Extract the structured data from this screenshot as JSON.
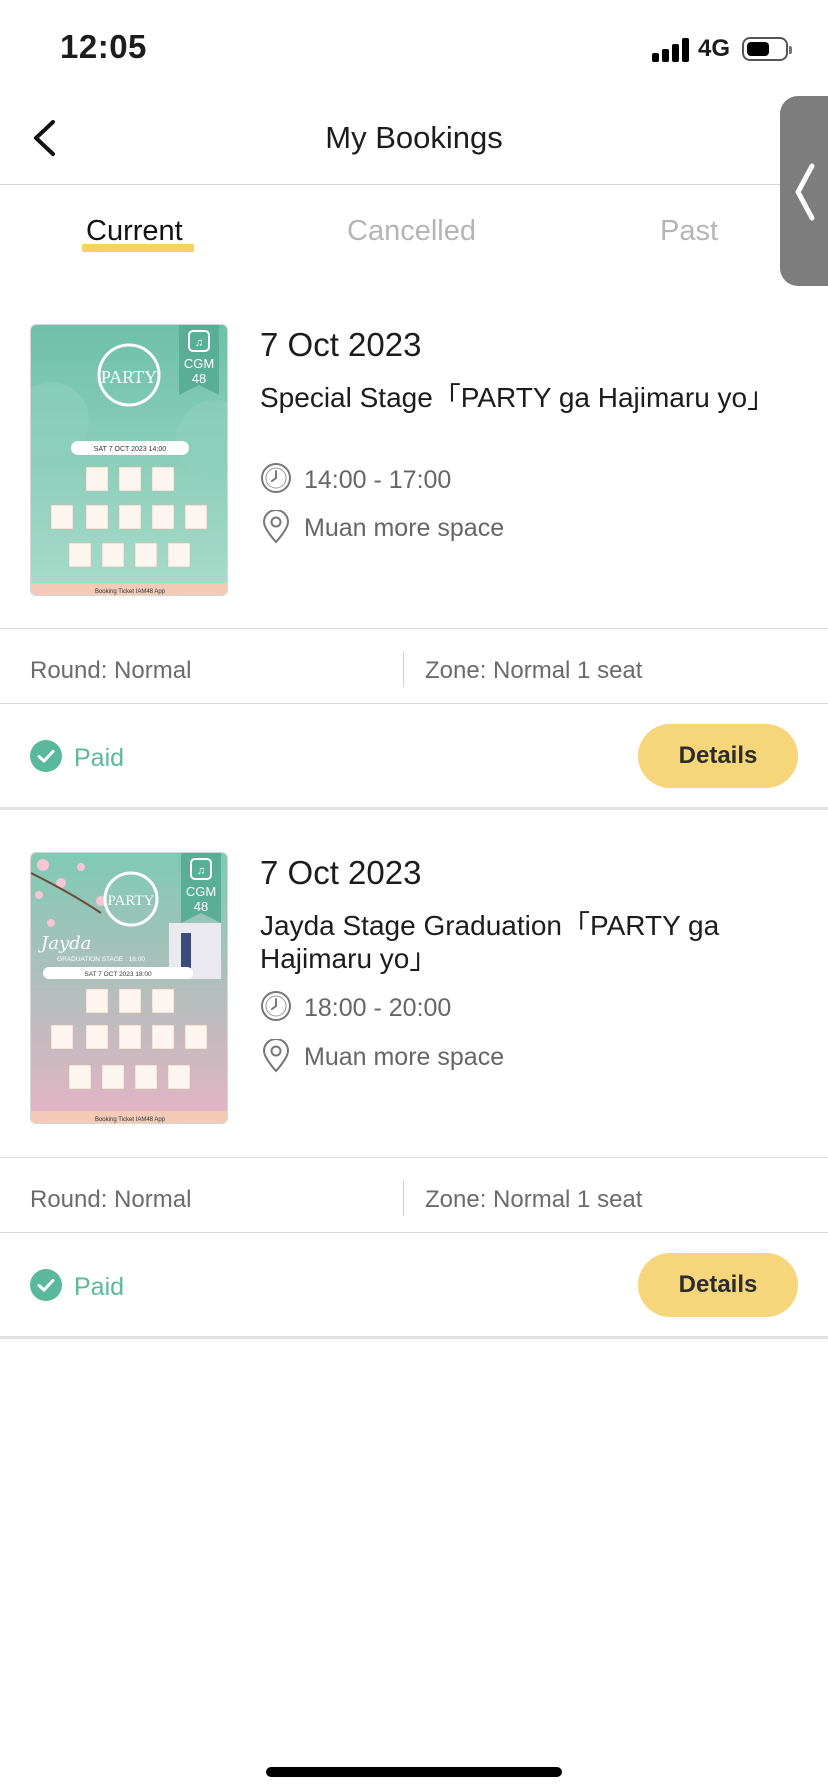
{
  "status_bar": {
    "time": "12:05",
    "network": "4G",
    "battery_level": 0.55
  },
  "nav": {
    "title": "My Bookings",
    "back_icon": "chevron-left-icon",
    "side_handle_icon": "chevron-left-icon"
  },
  "tabs": [
    {
      "label": "Current",
      "active": true
    },
    {
      "label": "Cancelled",
      "active": false
    },
    {
      "label": "Past",
      "active": false
    }
  ],
  "bookings": [
    {
      "date": "7 Oct 2023",
      "title": "Special Stage「PARTY ga Hajimaru yo」",
      "time": "14:00 - 17:00",
      "venue": "Muan more space",
      "round": "Round: Normal",
      "zone": "Zone: Normal 1 seat",
      "status": "Paid",
      "button": "Details",
      "poster": {
        "badge_line1": "CGM",
        "badge_line2": "48",
        "logo_text": "PARTY",
        "date_strip": "SAT  7 OCT 2023  14:00",
        "footer": "Booking Ticket  IAM48 App"
      }
    },
    {
      "date": "7 Oct 2023",
      "title": "Jayda Stage Graduation「PARTY ga Hajimaru yo」",
      "time": "18:00 - 20:00",
      "venue": "Muan more space",
      "round": "Round: Normal",
      "zone": "Zone: Normal 1 seat",
      "status": "Paid",
      "button": "Details",
      "poster": {
        "badge_line1": "CGM",
        "badge_line2": "48",
        "logo_text": "PARTY",
        "script_name": "Jayda",
        "subtitle": "GRADUATION STAGE : 18:00",
        "date_strip": "SAT  7 OCT 2023  18:00",
        "footer": "Booking Ticket  IAM48 App"
      }
    }
  ],
  "colors": {
    "accent_yellow": "#f6d67a",
    "paid_green": "#59b99a",
    "poster_teal": "#7ec9b2",
    "poster_pink": "#e7b5c4"
  }
}
